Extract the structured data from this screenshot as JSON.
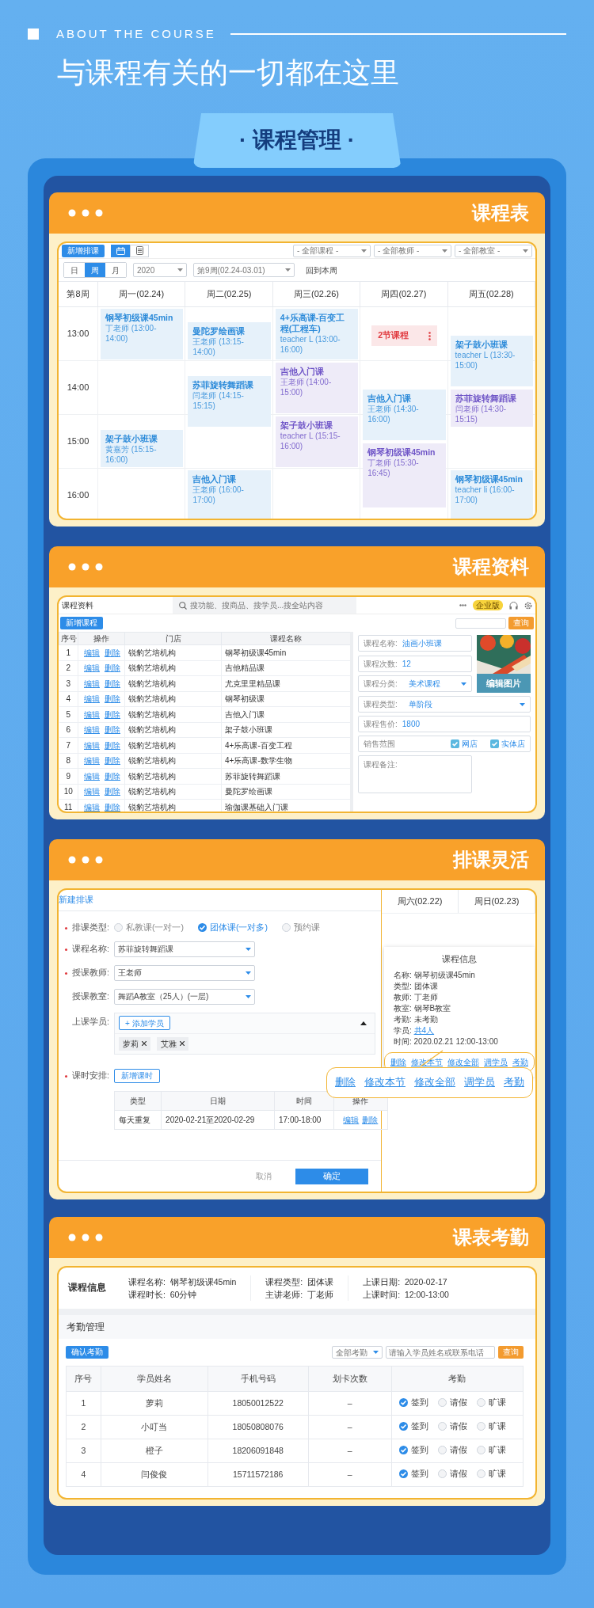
{
  "header": {
    "eyebrow": "ABOUT THE COURSE",
    "title": "与课程有关的一切都在这里",
    "tab": "· 课程管理 ·"
  },
  "schedule": {
    "title": "课程表",
    "add_button": "新增排课",
    "views": [
      {
        "kind": "calendar",
        "selected": true
      },
      {
        "kind": "list",
        "selected": false
      }
    ],
    "filters": [
      "- 全部课程 -",
      "- 全部教师 -",
      "- 全部教室 -"
    ],
    "modes": [
      {
        "label": "日",
        "selected": false
      },
      {
        "label": "周",
        "selected": true
      },
      {
        "label": "月",
        "selected": false
      }
    ],
    "year": "2020",
    "week": "第9周(02.24-03.01)",
    "today_link": "回到本周",
    "corner": "第8周",
    "times": [
      "13:00",
      "14:00",
      "15:00",
      "16:00"
    ],
    "days": [
      {
        "label": "周一(02.24)",
        "events": [
          {
            "kind": "course",
            "title": "钢琴初级课45min",
            "detail": "丁老师 (13:00-14:00)",
            "color": "#2b8ad9"
          },
          {
            "kind": "course",
            "title": "架子鼓小班课",
            "detail": "黄嘉芳 (15:15-16:00)",
            "color": "#2b8ad9"
          }
        ]
      },
      {
        "label": "周二(02.25)",
        "events": [
          {
            "kind": "course",
            "title": "曼陀罗绘画课",
            "detail": "王老师 (13:15-14:00)",
            "color": "#2b8ad9"
          },
          {
            "kind": "course",
            "title": "苏菲旋转舞蹈课",
            "detail": "闫老师 (14:15-15:15)",
            "color": "#2b8ad9"
          },
          {
            "kind": "course",
            "title": "吉他入门课",
            "detail": "王老师 (16:00-17:00)",
            "color": "#2b8ad9"
          }
        ]
      },
      {
        "label": "周三(02.26)",
        "events": [
          {
            "kind": "course",
            "title": "4+乐高课-百变工程(工程车)",
            "detail": "teacher L (13:00-16:00)",
            "color": "#2b8ad9"
          },
          {
            "kind": "course",
            "title": "吉他入门课",
            "detail": "王老师 (14:00-15:00)",
            "color": "#6f55c7"
          },
          {
            "kind": "course",
            "title": "架子鼓小班课",
            "detail": "teacher L (15:15-16:00)",
            "color": "#6f55c7"
          }
        ]
      },
      {
        "label": "周四(02.27)",
        "events": [
          {
            "kind": "more",
            "title": "2节课程",
            "color": "#e0393e"
          },
          {
            "kind": "course",
            "title": "吉他入门课",
            "detail": "王老师 (14:30-16:00)",
            "color": "#2b8ad9"
          },
          {
            "kind": "course",
            "title": "钢琴初级课45min",
            "detail": "丁老师 (15:30-16:45)",
            "color": "#6f55c7"
          }
        ]
      },
      {
        "label": "周五(02.28)",
        "events": [
          {
            "kind": "course",
            "title": "架子鼓小班课",
            "detail": "teacher L (13:30-15:00)",
            "color": "#2b8ad9"
          },
          {
            "kind": "course",
            "title": "苏菲旋转舞蹈课",
            "detail": "闫老师 (14:30-15:15)",
            "color": "#6f55c7"
          },
          {
            "kind": "course",
            "title": "钢琴初级课45min",
            "detail": "teacher li (16:00-17:00)",
            "color": "#2b8ad9"
          }
        ]
      }
    ]
  },
  "materials": {
    "title": "课程资料",
    "app_title": "课程资料",
    "search_placeholder": "搜功能、搜商品、搜学员...搜全站内容",
    "edition": "企业版",
    "add_button": "新增课程",
    "query_button": "查询",
    "columns": [
      "序号",
      "操作",
      "门店",
      "课程名称"
    ],
    "rows": [
      {
        "no": "1",
        "actions": [
          "编辑",
          "删除"
        ],
        "store": "锐豹艺培机构",
        "course": "钢琴初级课45min"
      },
      {
        "no": "2",
        "actions": [
          "编辑",
          "删除"
        ],
        "store": "锐豹艺培机构",
        "course": "吉他精品课"
      },
      {
        "no": "3",
        "actions": [
          "编辑",
          "删除"
        ],
        "store": "锐豹艺培机构",
        "course": "尤克里里精品课"
      },
      {
        "no": "4",
        "actions": [
          "编辑",
          "删除"
        ],
        "store": "锐豹艺培机构",
        "course": "钢琴初级课"
      },
      {
        "no": "5",
        "actions": [
          "编辑",
          "删除"
        ],
        "store": "锐豹艺培机构",
        "course": "吉他入门课"
      },
      {
        "no": "6",
        "actions": [
          "编辑",
          "删除"
        ],
        "store": "锐豹艺培机构",
        "course": "架子鼓小班课"
      },
      {
        "no": "7",
        "actions": [
          "编辑",
          "删除"
        ],
        "store": "锐豹艺培机构",
        "course": "4+乐高课-百变工程"
      },
      {
        "no": "8",
        "actions": [
          "编辑",
          "删除"
        ],
        "store": "锐豹艺培机构",
        "course": "4+乐高课-数学生物"
      },
      {
        "no": "9",
        "actions": [
          "编辑",
          "删除"
        ],
        "store": "锐豹艺培机构",
        "course": "苏菲旋转舞蹈课"
      },
      {
        "no": "10",
        "actions": [
          "编辑",
          "删除"
        ],
        "store": "锐豹艺培机构",
        "course": "曼陀罗绘画课"
      },
      {
        "no": "11",
        "actions": [
          "编辑",
          "删除"
        ],
        "store": "锐豹艺培机构",
        "course": "瑜伽课基础入门课"
      }
    ],
    "fields": [
      {
        "kind": "text",
        "label": "课程名称:",
        "value": "油画小班课"
      },
      {
        "kind": "text",
        "label": "课程次数:",
        "value": "12"
      },
      {
        "kind": "select",
        "label": "课程分类:",
        "value": "美术课程"
      },
      {
        "kind": "select",
        "label": "课程类型:",
        "value": "单阶段"
      },
      {
        "kind": "text",
        "label": "课程售价:",
        "value": "1800"
      },
      {
        "kind": "checks",
        "label": "销售范围",
        "options": [
          {
            "label": "网店",
            "checked": true
          },
          {
            "label": "实体店",
            "checked": true
          }
        ]
      },
      {
        "kind": "textarea",
        "label": "课程备注:"
      }
    ],
    "image_button": "编辑图片"
  },
  "arrange": {
    "title": "排课灵活",
    "form_title": "新建排课",
    "type_field": {
      "label": "排课类型:",
      "required": true,
      "options": [
        {
          "label": "私教课(一对一)",
          "selected": false
        },
        {
          "label": "团体课(一对多)",
          "selected": true
        },
        {
          "label": "预约课",
          "selected": false
        }
      ]
    },
    "selects": [
      {
        "label": "课程名称:",
        "required": true,
        "value": "苏菲旋转舞蹈课"
      },
      {
        "label": "授课教师:",
        "required": true,
        "value": "王老师"
      },
      {
        "label": "授课教室:",
        "required": false,
        "value": "舞蹈A教室（25人）(一层)"
      }
    ],
    "students": {
      "label": "上课学员:",
      "required": false,
      "add_button": "+ 添加学员",
      "tags": [
        "萝莉",
        "艾雅"
      ],
      "expanded": true
    },
    "lessons": {
      "label": "课时安排:",
      "required": true,
      "add_button": "新增课时",
      "columns": [
        "类型",
        "日期",
        "时间",
        "操作"
      ],
      "rows": [
        {
          "type": "每天重复",
          "date": "2020-02-21至2020-02-29",
          "time": "17:00-18:00",
          "actions": [
            "编辑",
            "删除"
          ]
        }
      ]
    },
    "cancel": "取消",
    "confirm": "确定",
    "calendar_days": [
      "周六(02.22)",
      "周日(02.23)"
    ],
    "popover": {
      "title": "课程信息",
      "lines": [
        {
          "label": "名称:",
          "value": "钢琴初级课45min",
          "link": false
        },
        {
          "label": "类型:",
          "value": "团体课",
          "link": false
        },
        {
          "label": "教师:",
          "value": "丁老师",
          "link": false
        },
        {
          "label": "教室:",
          "value": "钢琴B教室",
          "link": false
        },
        {
          "label": "考勤:",
          "value": "未考勤",
          "link": false
        },
        {
          "label": "学员:",
          "value": "共4人",
          "link": true
        },
        {
          "label": "时间:",
          "value": "2020.02.21 12:00-13:00",
          "link": false
        }
      ],
      "actions": [
        "删除",
        "修改本节",
        "修改全部",
        "调学员",
        "考勤"
      ]
    },
    "callout_actions": [
      "删除",
      "修改本节",
      "修改全部",
      "调学员",
      "考勤"
    ]
  },
  "attendance": {
    "title": "课表考勤",
    "info_label": "课程信息",
    "info": [
      {
        "label": "课程名称:",
        "value": "钢琴初级课45min"
      },
      {
        "label": "课程时长:",
        "value": "60分钟"
      },
      {
        "label": "课程类型:",
        "value": "团体课"
      },
      {
        "label": "主讲老师:",
        "value": "丁老师"
      },
      {
        "label": "上课日期:",
        "value": "2020-02-17"
      },
      {
        "label": "上课时间:",
        "value": "12:00-13:00"
      }
    ],
    "section": "考勤管理",
    "confirm_button": "确认考勤",
    "filter": "全部考勤",
    "search_placeholder": "请输入学员姓名或联系电话",
    "query_button": "查询",
    "columns": [
      "序号",
      "学员姓名",
      "手机号码",
      "划卡次数",
      "考勤"
    ],
    "rows": [
      {
        "no": "1",
        "name": "萝莉",
        "phone": "18050012522",
        "swipes": "–",
        "options": [
          {
            "label": "签到",
            "selected": true
          },
          {
            "label": "请假",
            "selected": false
          },
          {
            "label": "旷课",
            "selected": false
          }
        ]
      },
      {
        "no": "2",
        "name": "小叮当",
        "phone": "18050808076",
        "swipes": "–",
        "options": [
          {
            "label": "签到",
            "selected": true
          },
          {
            "label": "请假",
            "selected": false
          },
          {
            "label": "旷课",
            "selected": false
          }
        ]
      },
      {
        "no": "3",
        "name": "橙子",
        "phone": "18206091848",
        "swipes": "–",
        "options": [
          {
            "label": "签到",
            "selected": true
          },
          {
            "label": "请假",
            "selected": false
          },
          {
            "label": "旷课",
            "selected": false
          }
        ]
      },
      {
        "no": "4",
        "name": "闫俊俊",
        "phone": "15711572186",
        "swipes": "–",
        "options": [
          {
            "label": "签到",
            "selected": true
          },
          {
            "label": "请假",
            "selected": false
          },
          {
            "label": "旷课",
            "selected": false
          }
        ]
      }
    ]
  }
}
